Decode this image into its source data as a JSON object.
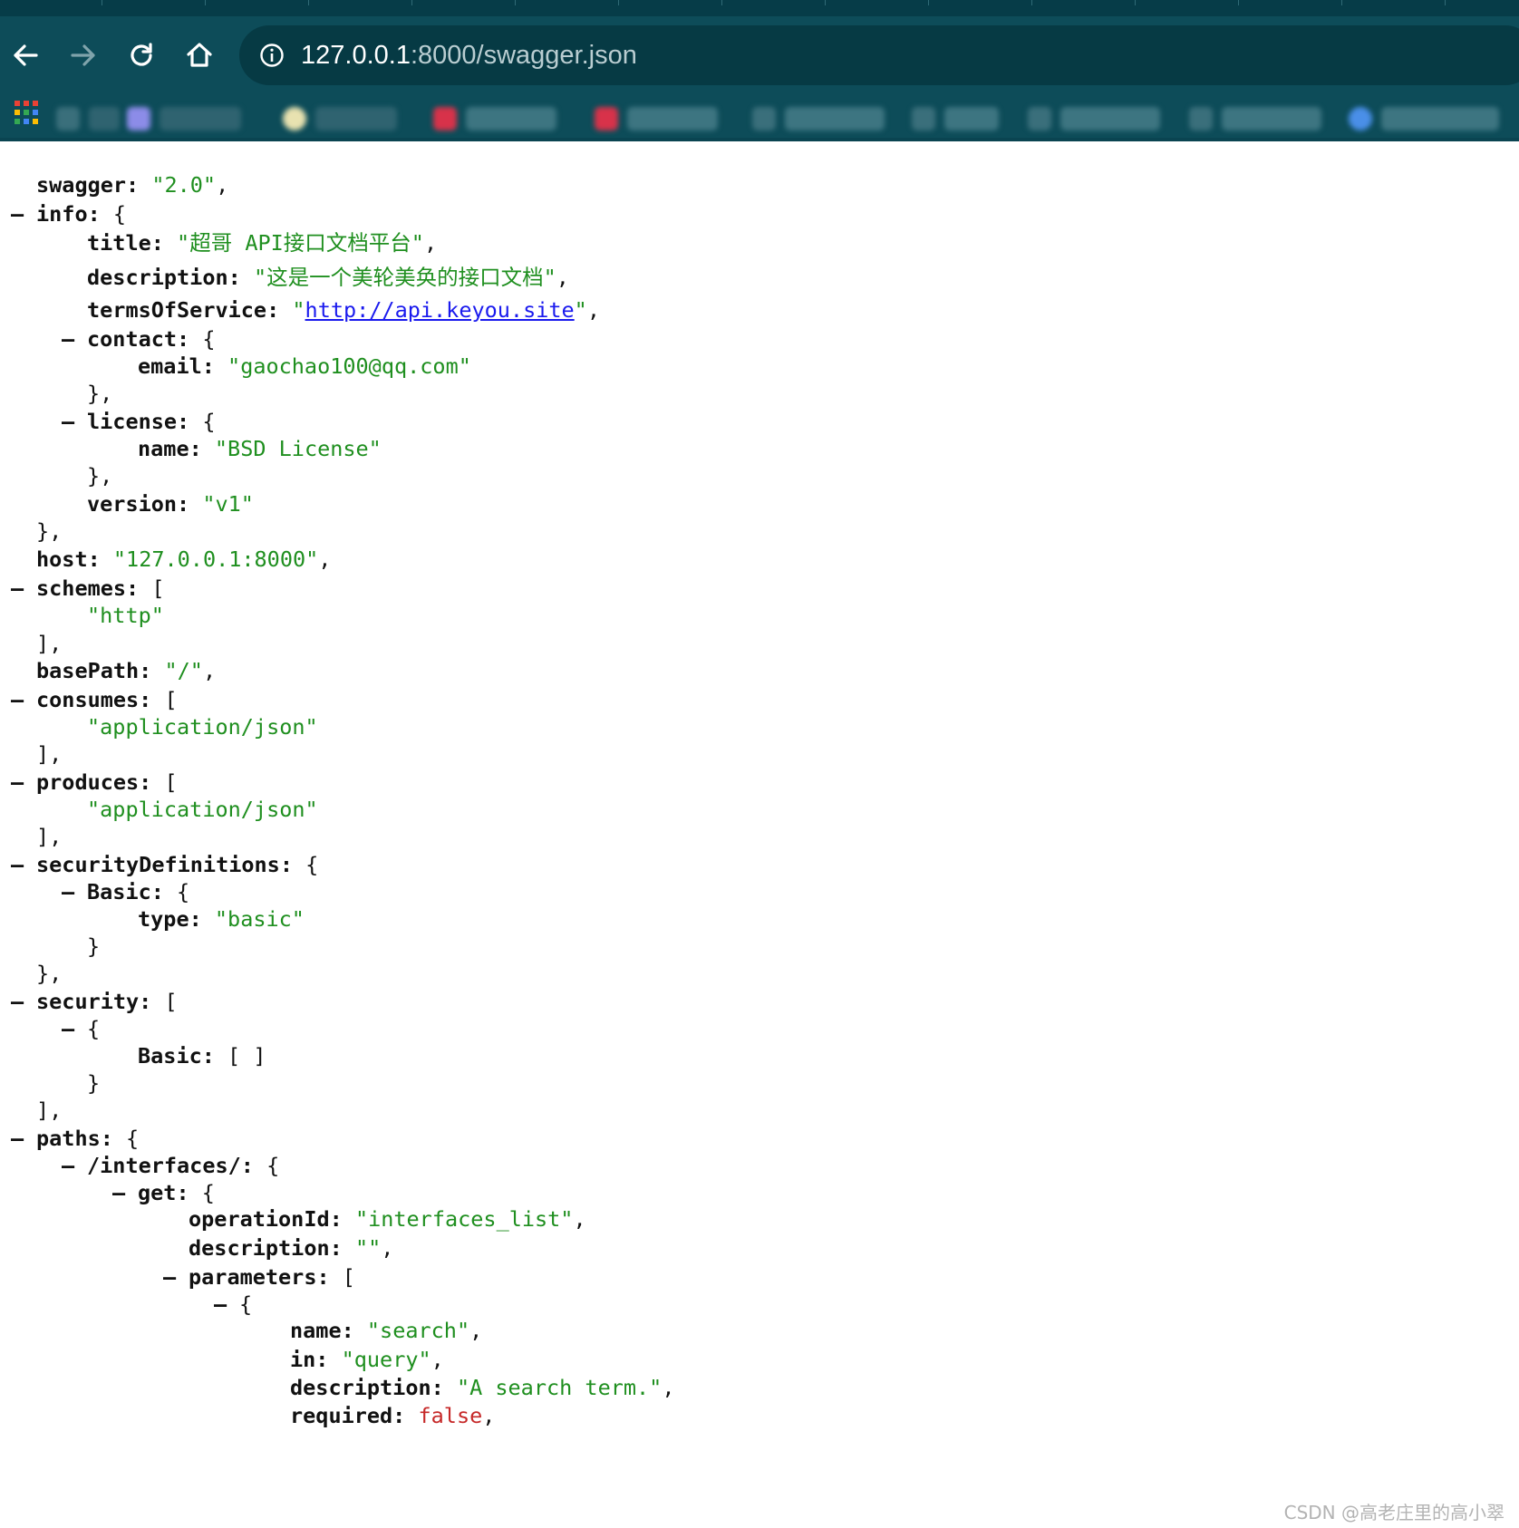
{
  "browser": {
    "url_host": "127.0.0.1",
    "url_rest": ":8000/swagger.json",
    "accent_color": "#0d4c59"
  },
  "json": {
    "swagger": {
      "key": "swagger:",
      "value": "\"2.0\""
    },
    "info": {
      "key": "info:",
      "title": {
        "key": "title:",
        "value": "\"超哥 API接口文档平台\""
      },
      "description": {
        "key": "description:",
        "value": "\"这是一个美轮美奂的接口文档\""
      },
      "termsOfService": {
        "key": "termsOfService:",
        "value": "http://api.keyou.site"
      },
      "contact": {
        "key": "contact:",
        "email_key": "email:",
        "email_value": "\"gaochao100@qq.com\""
      },
      "license": {
        "key": "license:",
        "name_key": "name:",
        "name_value": "\"BSD License\""
      },
      "version": {
        "key": "version:",
        "value": "\"v1\""
      }
    },
    "host": {
      "key": "host:",
      "value": "\"127.0.0.1:8000\""
    },
    "schemes": {
      "key": "schemes:",
      "items": [
        "\"http\""
      ]
    },
    "basePath": {
      "key": "basePath:",
      "value": "\"/\""
    },
    "consumes": {
      "key": "consumes:",
      "items": [
        "\"application/json\""
      ]
    },
    "produces": {
      "key": "produces:",
      "items": [
        "\"application/json\""
      ]
    },
    "securityDefinitions": {
      "key": "securityDefinitions:",
      "basic_key": "Basic:",
      "type_key": "type:",
      "type_value": "\"basic\""
    },
    "security": {
      "key": "security:",
      "basic_key": "Basic:",
      "basic_value": "[ ]"
    },
    "paths": {
      "key": "paths:",
      "route_key": "/interfaces/:",
      "get_key": "get:",
      "operationId": {
        "key": "operationId:",
        "value": "\"interfaces_list\""
      },
      "description": {
        "key": "description:",
        "value": "\"\""
      },
      "parameters_key": "parameters:",
      "param": {
        "name_key": "name:",
        "name_value": "\"search\"",
        "in_key": "in:",
        "in_value": "\"query\"",
        "description_key": "description:",
        "description_value": "\"A search term.\"",
        "required_key": "required:",
        "required_value": "false"
      }
    }
  },
  "watermark": "CSDN @高老庄里的高小翠"
}
